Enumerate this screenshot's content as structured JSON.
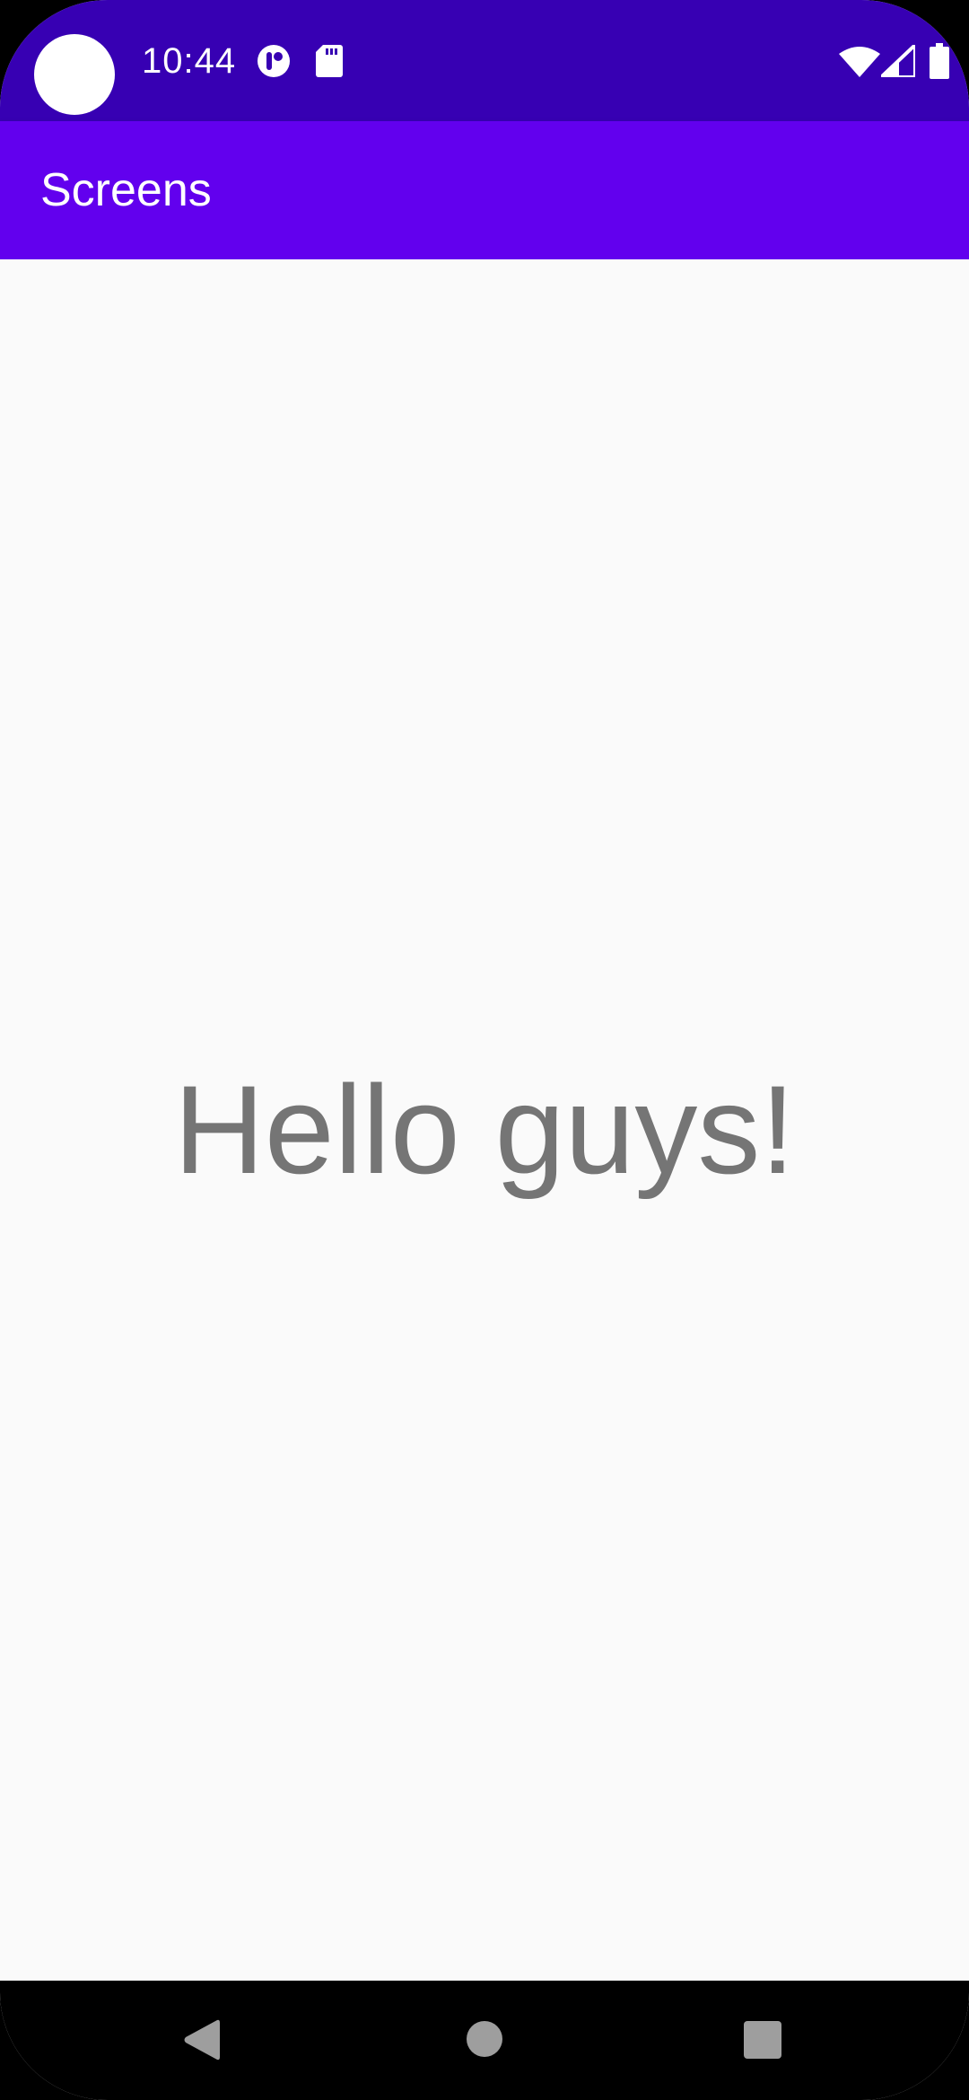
{
  "status_bar": {
    "time": "10:44",
    "background": "#3700B3",
    "icons": [
      "camera-cutout",
      "notification-app-icon",
      "sd-card-icon",
      "wifi-icon",
      "cell-signal-icon",
      "battery-icon"
    ]
  },
  "app_bar": {
    "title": "Screens",
    "background": "#6200EE"
  },
  "content": {
    "greeting": "Hello guys!",
    "text_color": "#757575",
    "background": "#FAFAFA"
  },
  "nav_bar": {
    "buttons": [
      "back-icon",
      "home-icon",
      "recents-icon"
    ],
    "background": "#000000"
  }
}
